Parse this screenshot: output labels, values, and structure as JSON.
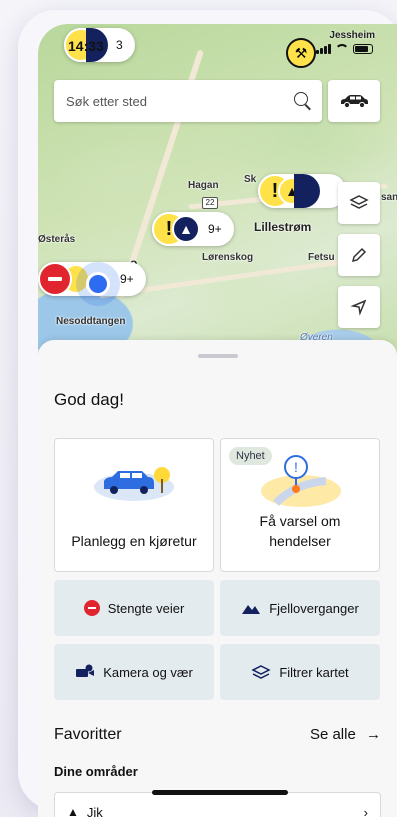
{
  "status": {
    "time": "14:33",
    "location_label": "Jessheim"
  },
  "map": {
    "places": {
      "hagan": "Hagan",
      "skedsmo": "Sk",
      "lillestrom": "Lillestrøm",
      "osteras": "Østerås",
      "oslo": "o",
      "lorenskog": "Lørenskog",
      "fetsund": "Fetsu",
      "nesoddtangen": "Nesoddtangen",
      "oyeren": "Øyeren",
      "edge_san": "san",
      "road_22": "22"
    },
    "clusters": {
      "top_left_count": "3",
      "lillestrom_count": "9+",
      "oslo_count": "9+"
    }
  },
  "search": {
    "placeholder": "Søk etter sted"
  },
  "sheet": {
    "greeting": "God dag!",
    "plan_trip": "Planlegg en kjøretur",
    "alerts": "Få varsel om hendelser",
    "new_badge": "Nyhet",
    "closed_roads": "Stengte veier",
    "mountain_passes": "Fjelloverganger",
    "camera_weather": "Kamera og vær",
    "filter_map": "Filtrer kartet",
    "favorites_title": "Favoritter",
    "see_all": "Se alle",
    "my_areas": "Dine områder",
    "area_item": "Jik"
  },
  "colors": {
    "warning": "#ffe24a",
    "navy": "#13225e",
    "stop": "#e0252f",
    "accent_blue": "#2d6cf0"
  }
}
